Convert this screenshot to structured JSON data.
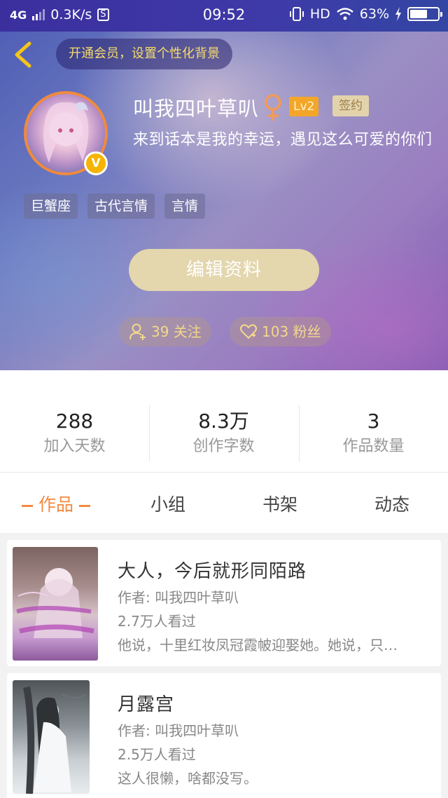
{
  "status_bar": {
    "network": "4G",
    "speed": "0.3K/s",
    "s_badge": "S",
    "time": "09:52",
    "hd": "HD",
    "battery": "63%",
    "battery_level": 0.63
  },
  "header": {
    "vip_prompt": "开通会员，设置个性化背景",
    "username": "叫我四叶草叭",
    "level": "Lv2",
    "signed": "签约",
    "avatar_badge": "V",
    "bio": "来到话本是我的幸运，遇见这么可爱的你们",
    "tags": [
      "巨蟹座",
      "古代言情",
      "言情"
    ],
    "edit_button": "编辑资料",
    "follow": "39 关注",
    "fans": "103 粉丝"
  },
  "stats": [
    {
      "value": "288",
      "label": "加入天数"
    },
    {
      "value": "8.3万",
      "label": "创作字数"
    },
    {
      "value": "3",
      "label": "作品数量"
    }
  ],
  "tabs": [
    "作品",
    "小组",
    "书架",
    "动态"
  ],
  "books": [
    {
      "title": "大人，今后就形同陌路",
      "author": "作者: 叫我四叶草叭",
      "views": "2.7万人看过",
      "summary": "他说，十里红妆凤冠霞帔迎娶她。她说，只…"
    },
    {
      "title": "月露宫",
      "author": "作者: 叫我四叶草叭",
      "views": "2.5万人看过",
      "summary": "这人很懒，啥都没写。"
    }
  ],
  "colors": {
    "accent": "#f38a40",
    "gold_text": "#f2d98a",
    "edit_button_bg": "#e4d6ad",
    "female_symbol": "#f39a55"
  }
}
